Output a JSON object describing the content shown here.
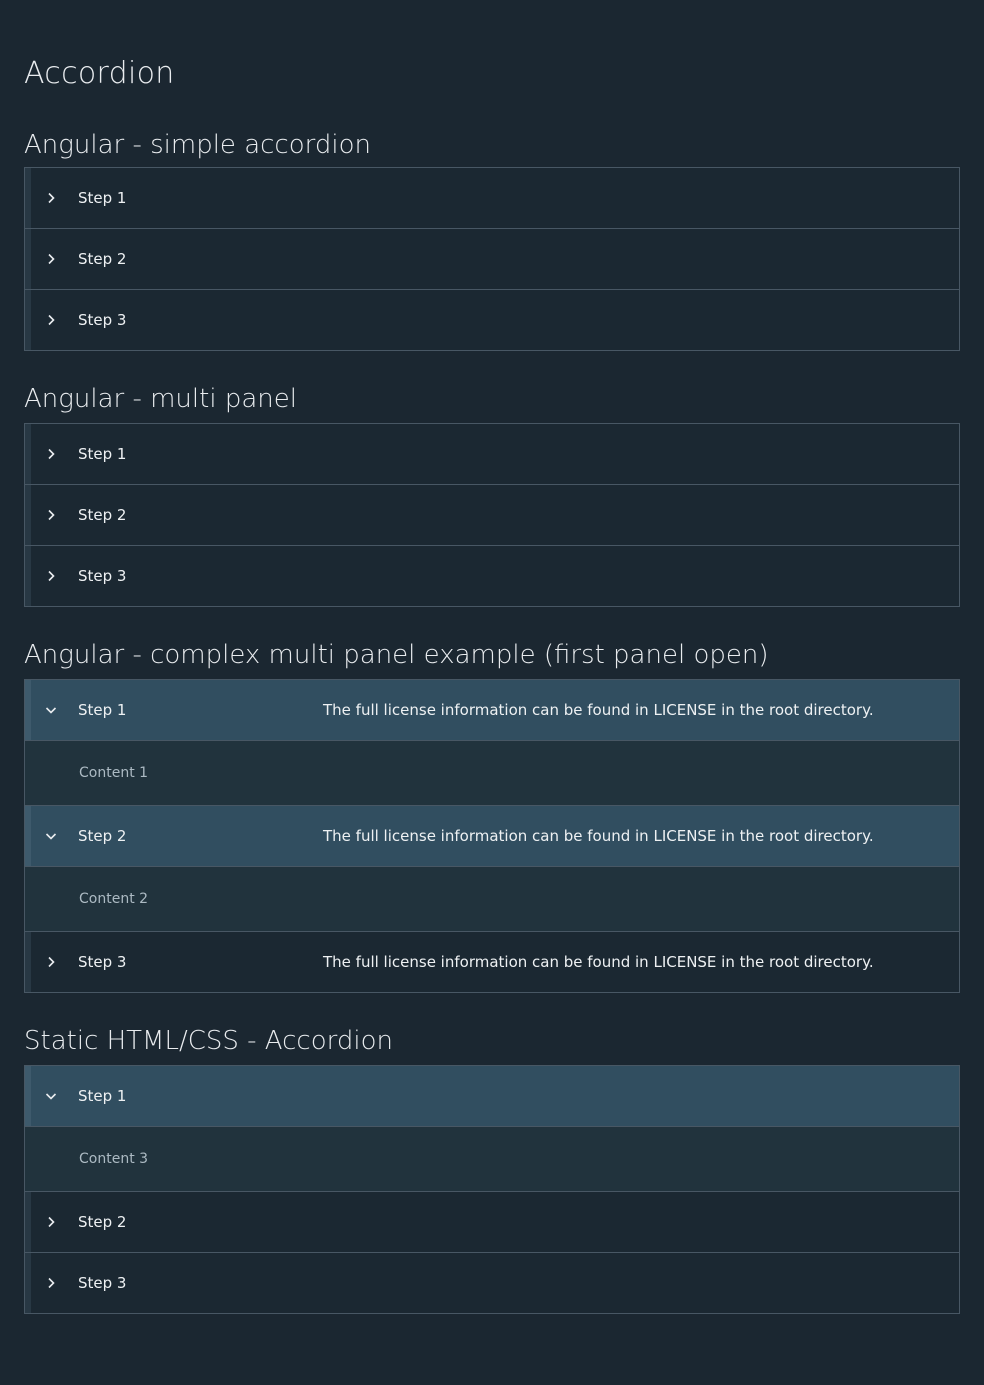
{
  "page": {
    "title": "Accordion"
  },
  "sections": {
    "simple": {
      "title": "Angular - simple accordion",
      "panels": [
        {
          "label": "Step 1"
        },
        {
          "label": "Step 2"
        },
        {
          "label": "Step 3"
        }
      ]
    },
    "multi": {
      "title": "Angular - multi panel",
      "panels": [
        {
          "label": "Step 1"
        },
        {
          "label": "Step 2"
        },
        {
          "label": "Step 3"
        }
      ]
    },
    "complex": {
      "title": "Angular - complex multi panel example (first panel open)",
      "panels": [
        {
          "label": "Step 1",
          "description": "The full license information can be found in LICENSE in the root directory.",
          "content": "Content 1",
          "open": true
        },
        {
          "label": "Step 2",
          "description": "The full license information can be found in LICENSE in the root directory.",
          "content": "Content 2",
          "open": true
        },
        {
          "label": "Step 3",
          "description": "The full license information can be found in LICENSE in the root directory.",
          "open": false
        }
      ]
    },
    "static": {
      "title": "Static HTML/CSS - Accordion",
      "panels": [
        {
          "label": "Step 1",
          "content": "Content 3",
          "open": true
        },
        {
          "label": "Step 2",
          "open": false
        },
        {
          "label": "Step 3",
          "open": false
        }
      ]
    }
  },
  "icons": {
    "collapsed": "chevron-right-icon",
    "expanded": "chevron-down-icon"
  },
  "colors": {
    "background": "#1b2731",
    "panel_open_header": "#314e60",
    "panel_content": "#21333d",
    "border": "#485764"
  }
}
